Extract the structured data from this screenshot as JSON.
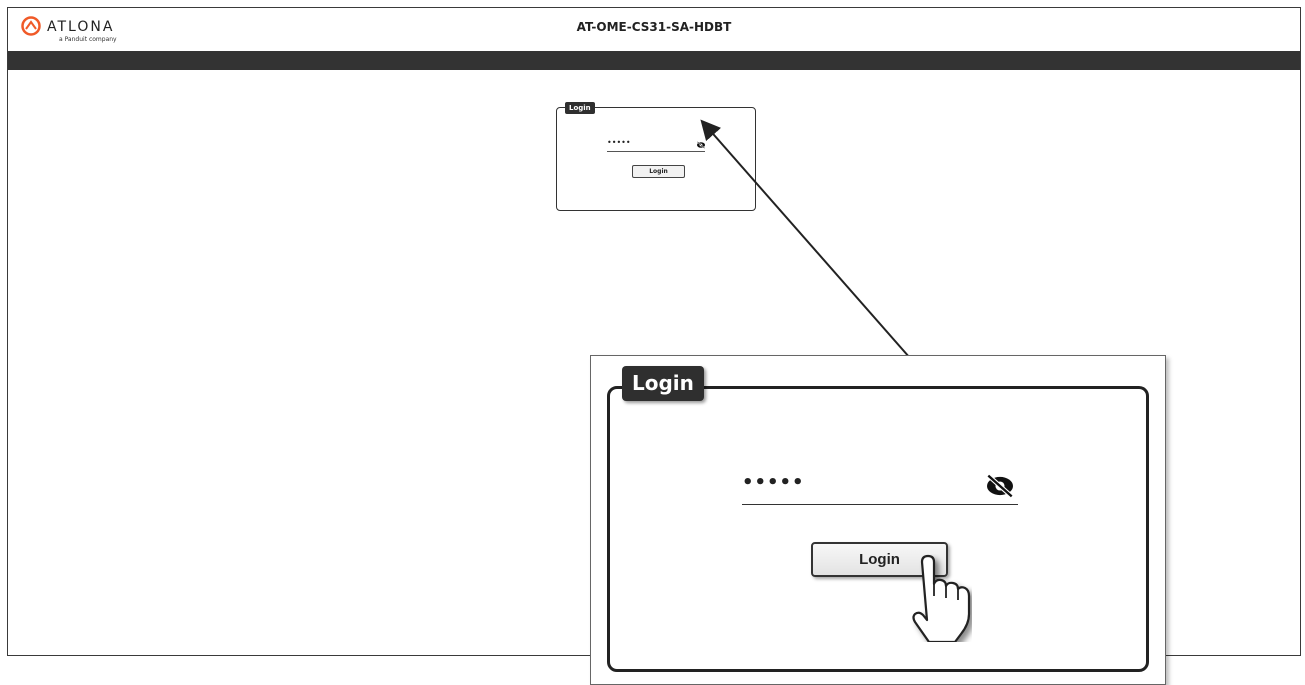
{
  "header": {
    "brand": "ATLONA",
    "brand_sub": "a Panduit company",
    "title": "AT-OME-CS31-SA-HDBT"
  },
  "login_panel": {
    "legend": "Login",
    "password_mask": "•••••",
    "button_label": "Login"
  },
  "zoom": {
    "legend": "Login",
    "password_mask": "•••••",
    "button_label": "Login"
  },
  "icons": {
    "eye": "eye-slash-icon",
    "hand": "pointing-hand-cursor-icon",
    "logo": "atlona-logo-icon"
  },
  "colors": {
    "navbar": "#333333",
    "legend_bg": "#2f2f2f",
    "arrow": "#222222"
  }
}
